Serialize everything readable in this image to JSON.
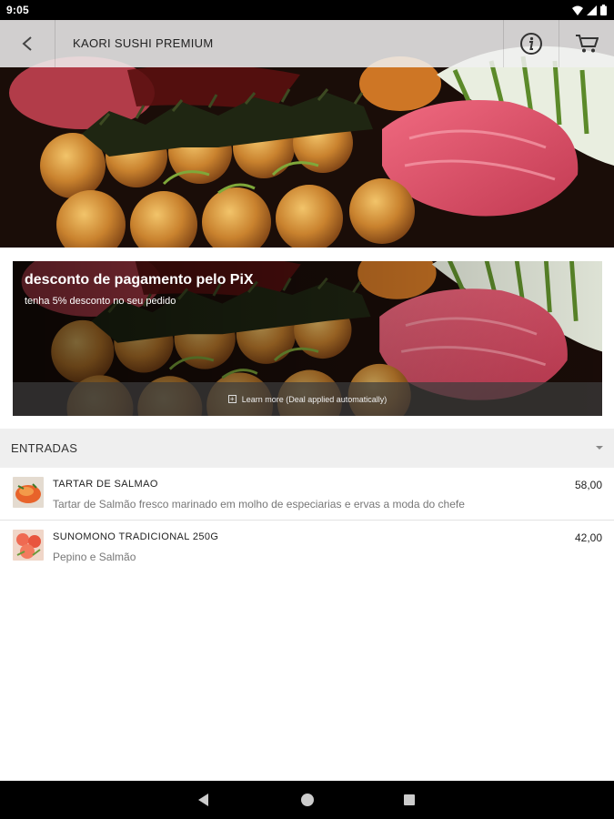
{
  "status_bar": {
    "time": "9:05"
  },
  "header": {
    "title": "KAORI SUSHI PREMIUM"
  },
  "deal_banner": {
    "title": "desconto de pagamento pelo PiX",
    "subtitle": "tenha 5% desconto no seu pedido",
    "footer": "Learn more (Deal applied automatically)"
  },
  "section": {
    "title": "ENTRADAS"
  },
  "menu_items": [
    {
      "name": "TARTAR DE SALMAO",
      "description": "Tartar de Salmão fresco marinado em molho de especiarias e ervas a moda do chefe",
      "price": "58,00"
    },
    {
      "name": "SUNOMONO TRADICIONAL 250G",
      "description": "Pepino e Salmão",
      "price": "42,00"
    }
  ]
}
